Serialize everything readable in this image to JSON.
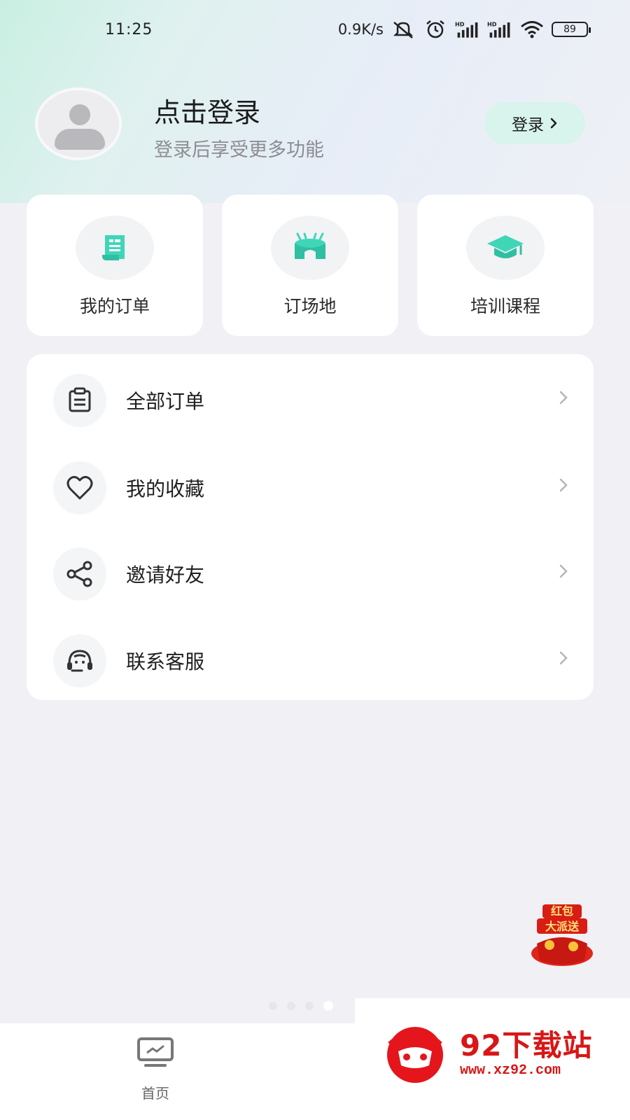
{
  "status_bar": {
    "time": "11:25",
    "net_speed": "0.9K/s",
    "icons": [
      "mute-icon",
      "alarm-icon",
      "signal-hd-icon",
      "signal-hd-icon",
      "wifi-icon"
    ],
    "battery": "89"
  },
  "profile": {
    "title": "点击登录",
    "subtitle": "登录后享受更多功能",
    "login_button": "登录"
  },
  "quick_actions": [
    {
      "label": "我的订单",
      "icon": "receipt-icon"
    },
    {
      "label": "订场地",
      "icon": "stadium-icon"
    },
    {
      "label": "培训课程",
      "icon": "graduation-cap-icon"
    }
  ],
  "menu": [
    {
      "label": "全部订单",
      "icon": "clipboard-icon"
    },
    {
      "label": "我的收藏",
      "icon": "heart-icon"
    },
    {
      "label": "邀请好友",
      "icon": "share-icon"
    },
    {
      "label": "联系客服",
      "icon": "headset-icon"
    }
  ],
  "floating_badge": {
    "text": "红包大派送"
  },
  "bottom_nav": {
    "home_label": "首页"
  },
  "watermark": {
    "title": "92下载站",
    "url": "www.xz92.com"
  },
  "colors": {
    "accent": "#3fd6b8",
    "background": "#f0f0f5",
    "login_button_bg": "#d8f4ec",
    "watermark_red": "#d81616"
  }
}
